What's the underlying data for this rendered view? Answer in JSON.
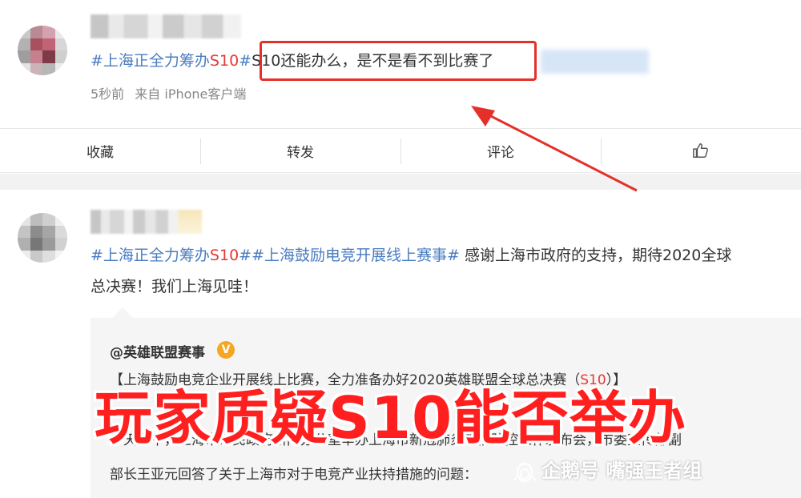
{
  "post1": {
    "hashtag": "#上海正全力筹办S10#",
    "hashtag_parts": [
      "#上海正全力筹办",
      "S10",
      "#"
    ],
    "text": "S10还能办么，是不是看不到比赛了",
    "time": "5秒前",
    "source": "来自 iPhone客户端"
  },
  "actions": {
    "collect": "收藏",
    "repost": "转发",
    "comment": "评论",
    "like_icon": "thumbs-up-icon"
  },
  "post2": {
    "tag1_parts": [
      "#上海正全力筹办",
      "S10",
      "#"
    ],
    "tag2": "#上海鼓励电竞开展线上赛事#",
    "text_line1": " 感谢上海市政府的支持，期待2020全球",
    "text_line2": "总决赛！我们上海见哇！"
  },
  "repost": {
    "author": "@英雄联盟赛事",
    "badge": "V",
    "line1_parts": [
      "【上海鼓励电竞企业开展线上比赛，全力准备办好2020英雄联盟全球总决赛（",
      "S10",
      "）】"
    ],
    "line2": "今天上午，上海市人民政府新闻办公室举办上海市新冠肺炎疫情防控工作发布会，市委宣传部副",
    "line3": "部长王亚元回答了关于上海市对于电竞产业扶持措施的问题："
  },
  "overlay": {
    "caption": "玩家质疑S10能否举办"
  },
  "watermark": {
    "text": "企鹅号 嘴强王者组"
  },
  "colors": {
    "topic_blue": "#4a7cc0",
    "s10_red": "#e53935",
    "highlight_red": "#e5302a",
    "caption_red": "#ff1f1f"
  }
}
